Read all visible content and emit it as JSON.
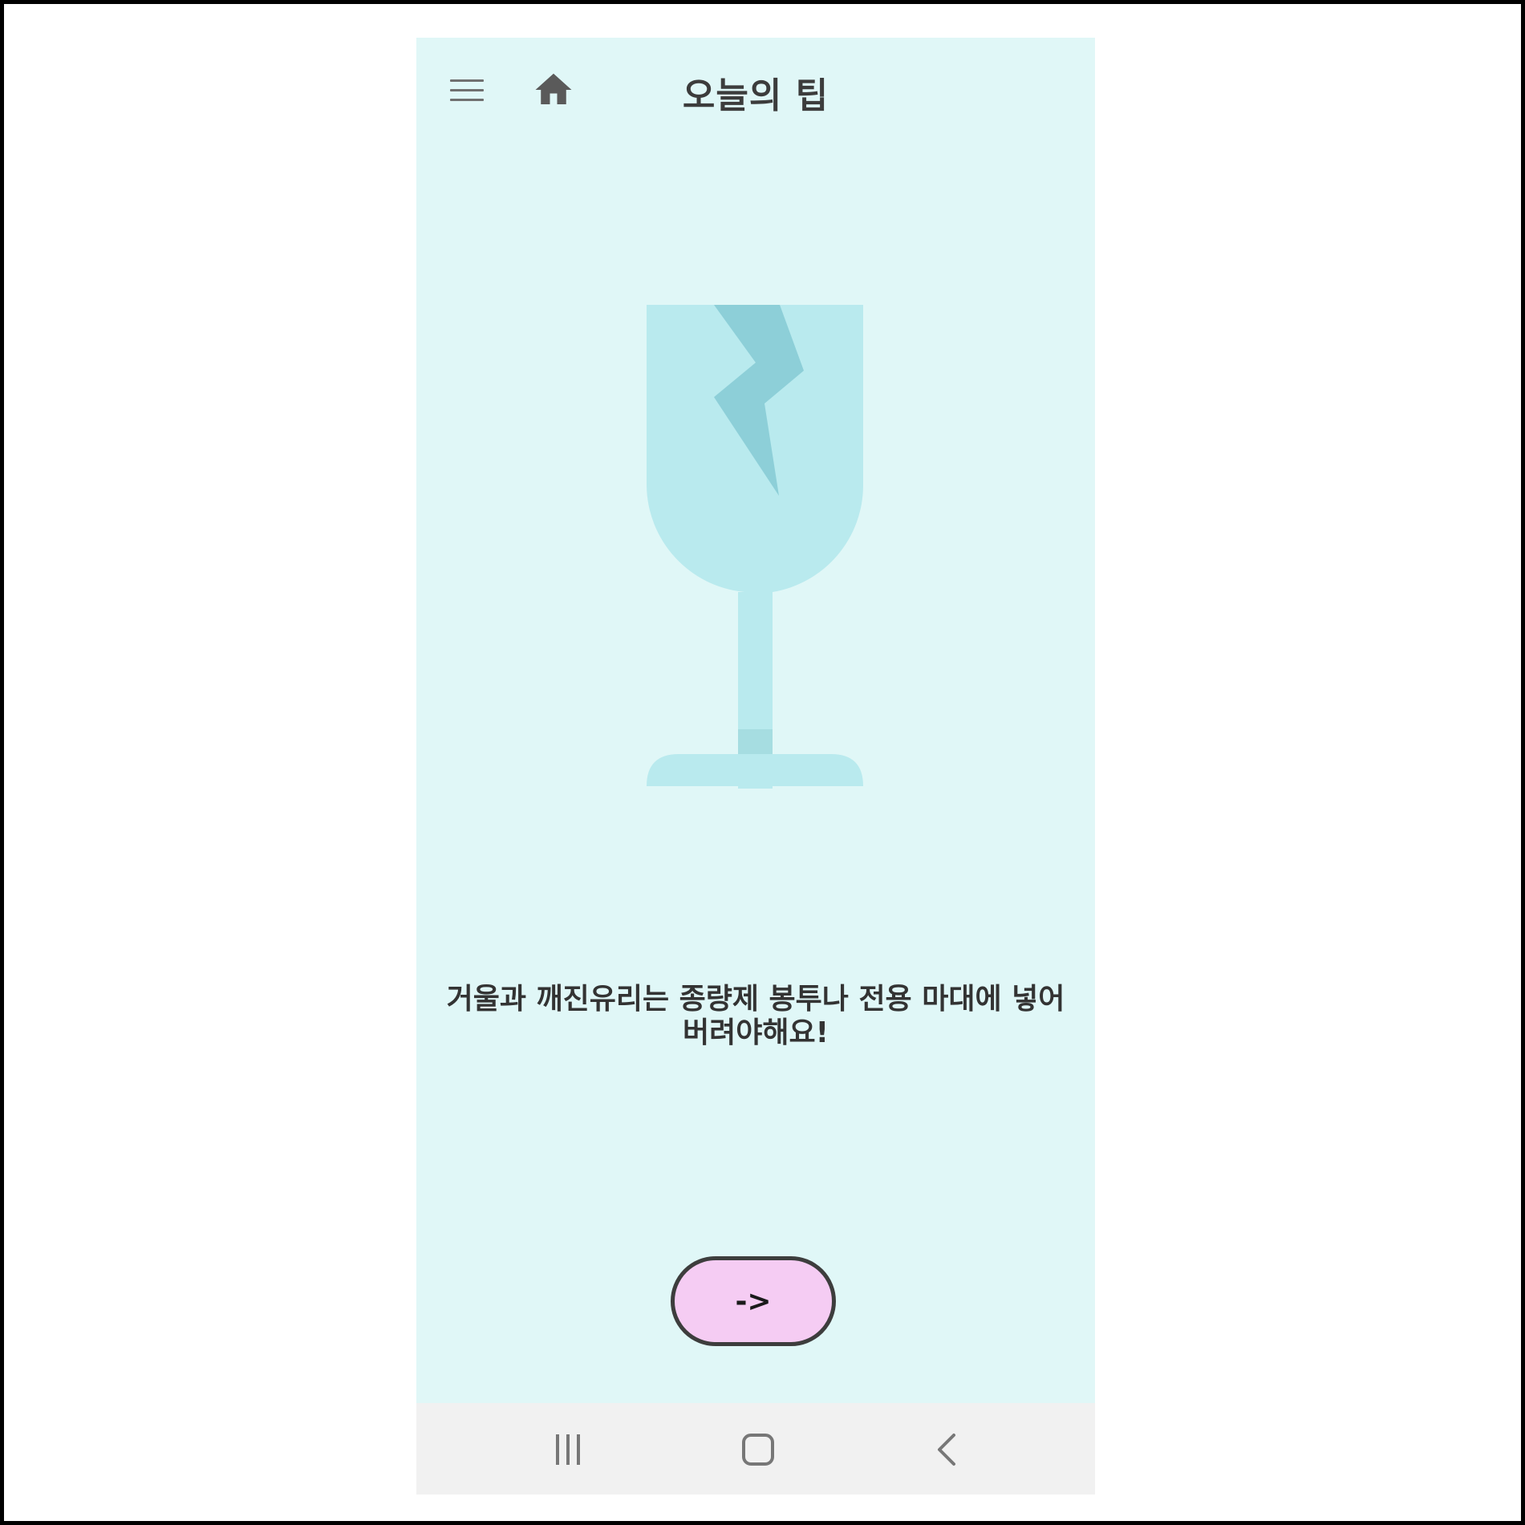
{
  "header": {
    "title": "오늘의 팁",
    "menu_icon": "menu-icon",
    "home_icon": "home-icon"
  },
  "tip": {
    "illustration": "broken-glass-icon",
    "text": "거울과 깨진유리는 종량제 봉투나 전용 마대에 넣어 버려야해요!"
  },
  "next_button": {
    "label": "->"
  },
  "system_nav": {
    "recents_icon": "recents-icon",
    "home_icon": "system-home-icon",
    "back_icon": "back-icon"
  },
  "colors": {
    "background": "#e0f7f7",
    "glass": "#b9eaee",
    "crack": "#8dcfd8",
    "button_fill": "#f5ccf3",
    "nav_bar": "#f1f1f1"
  }
}
